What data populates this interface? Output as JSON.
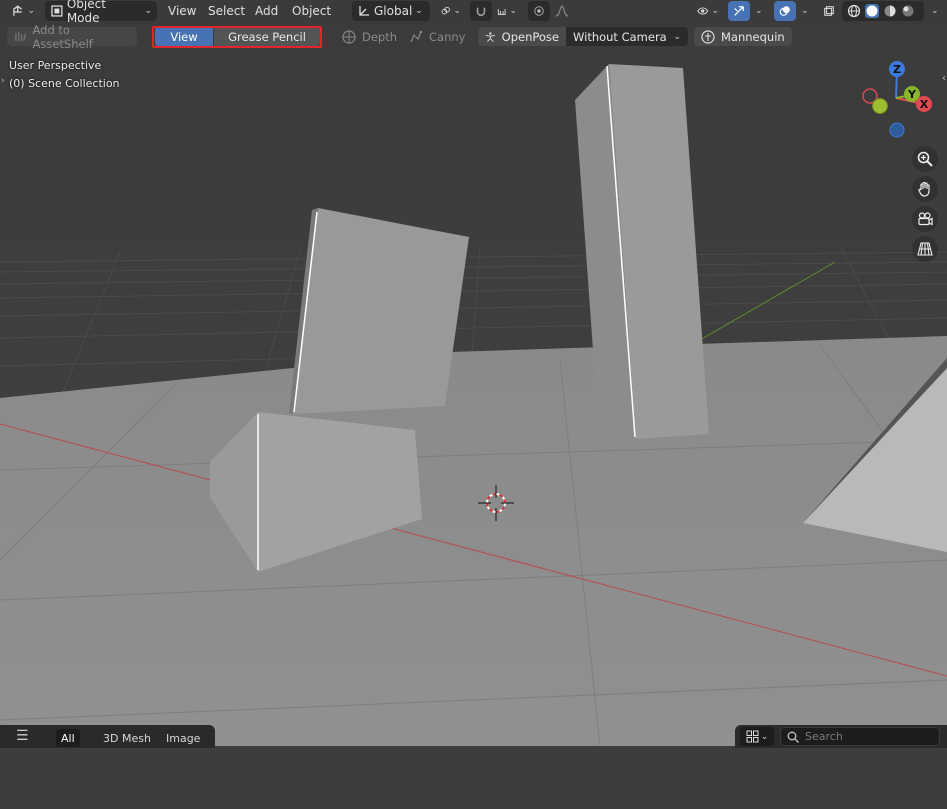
{
  "header": {
    "mode": "Object Mode",
    "menus": [
      "View",
      "Select",
      "Add",
      "Object"
    ],
    "transform_orientation": "Global"
  },
  "toolbar2": {
    "asset_shelf": "Add to AssetShelf",
    "view": "View",
    "grease_pencil": "Grease Pencil",
    "depth": "Depth",
    "canny": "Canny",
    "openpose": "OpenPose",
    "camera_option": "Without Camera",
    "mannequin": "Mannequin"
  },
  "viewport": {
    "perspective_label": "User Perspective",
    "collection_label": "(0) Scene Collection",
    "gizmo": {
      "z": "Z",
      "y": "Y",
      "x": "X"
    }
  },
  "asset_shelf": {
    "tabs": [
      "All",
      "3D Mesh",
      "Image"
    ],
    "selected_tab": "All",
    "search_placeholder": "Search"
  },
  "colors": {
    "accent": "#4772b3",
    "highlight": "#e3242b",
    "axis_x": "#e04a50",
    "axis_y": "#8ab52d",
    "axis_z": "#3d7ae0"
  }
}
